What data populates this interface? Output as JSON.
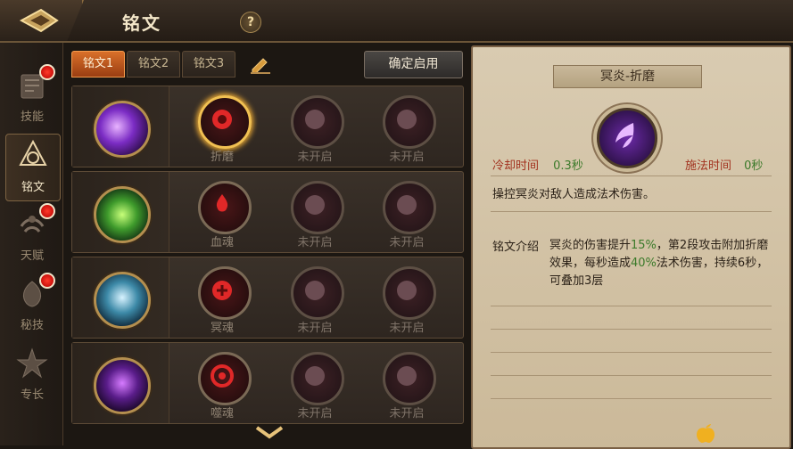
{
  "header": {
    "title": "铭文",
    "help": "?"
  },
  "nav": [
    {
      "label": "技能",
      "icon": "skill-book-icon",
      "dot": true
    },
    {
      "label": "铭文",
      "icon": "inscription-icon",
      "dot": false,
      "active": true
    },
    {
      "label": "天赋",
      "icon": "talent-icon",
      "dot": true
    },
    {
      "label": "秘技",
      "icon": "secret-skill-icon",
      "dot": true
    },
    {
      "label": "专长",
      "icon": "specialty-icon",
      "dot": false
    }
  ],
  "tabs": [
    {
      "label": "铭文1",
      "active": true
    },
    {
      "label": "铭文2",
      "active": false
    },
    {
      "label": "铭文3",
      "active": false
    }
  ],
  "confirm_button": "确定启用",
  "rows": [
    {
      "skill_icon": "purple-flame-skill-icon",
      "slots": [
        {
          "label": "折磨",
          "state": "selected"
        },
        {
          "label": "未开启",
          "state": "locked"
        },
        {
          "label": "未开启",
          "state": "locked"
        }
      ]
    },
    {
      "skill_icon": "green-blades-skill-icon",
      "slots": [
        {
          "label": "血魂",
          "state": "open"
        },
        {
          "label": "未开启",
          "state": "locked"
        },
        {
          "label": "未开启",
          "state": "locked"
        }
      ]
    },
    {
      "skill_icon": "skeleton-king-skill-icon",
      "slots": [
        {
          "label": "冥魂",
          "state": "open"
        },
        {
          "label": "未开启",
          "state": "locked"
        },
        {
          "label": "未开启",
          "state": "locked"
        }
      ]
    },
    {
      "skill_icon": "shadow-beast-skill-icon",
      "slots": [
        {
          "label": "噬魂",
          "state": "open"
        },
        {
          "label": "未开启",
          "state": "locked"
        },
        {
          "label": "未开启",
          "state": "locked"
        }
      ]
    }
  ],
  "detail": {
    "title": "冥炎-折磨",
    "cooldown_label": "冷却时间",
    "cooldown_value": "0.3秒",
    "cast_label": "施法时间",
    "cast_value": "0秒",
    "description": "操控冥炎对敌人造成法术伤害。",
    "intro_label": "铭文介绍",
    "intro_part1": "冥炎的伤害提升",
    "intro_hl1": "15%",
    "intro_part2": "，第2段攻击附加折磨效果，每秒造成",
    "intro_hl2": "40%",
    "intro_part3": "法术伤害，持续6秒，可叠加3层"
  },
  "colors": {
    "accent_tab": "#d9702a",
    "stat_label": "#a2321f",
    "stat_value": "#3b7a2a"
  }
}
